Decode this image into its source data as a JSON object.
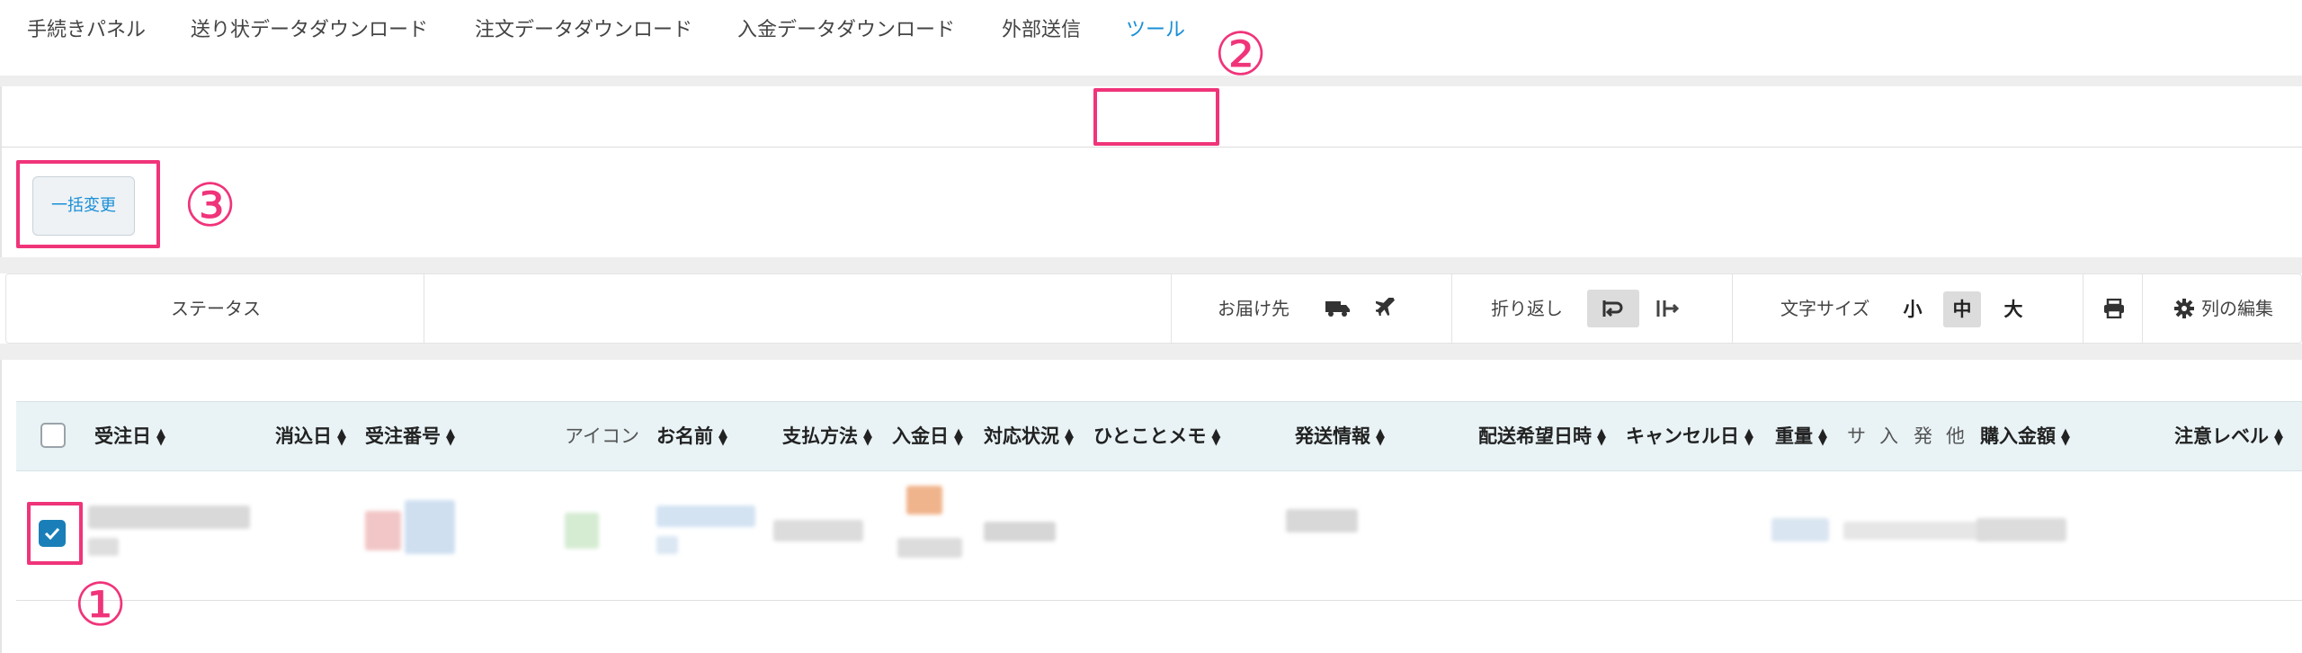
{
  "tabs": [
    {
      "label": "手続きパネル",
      "active": false
    },
    {
      "label": "送り状データダウンロード",
      "active": false
    },
    {
      "label": "注文データダウンロード",
      "active": false
    },
    {
      "label": "入金データダウンロード",
      "active": false
    },
    {
      "label": "外部送信",
      "active": false
    },
    {
      "label": "ツール",
      "active": true
    }
  ],
  "toolbar": {
    "bulk_change_label": "一括変更"
  },
  "filter_bar": {
    "status_label": "ステータス",
    "delivery_label": "お届け先",
    "wrap_label": "折り返し",
    "font_size_label": "文字サイズ",
    "size_small": "小",
    "size_medium": "中",
    "size_large": "大",
    "selected_size": "中",
    "edit_columns_label": "列の編集",
    "icons": [
      "truck-icon",
      "airplane-icon",
      "wrap-on-icon",
      "wrap-off-icon",
      "print-icon",
      "gear-icon"
    ]
  },
  "table": {
    "columns": [
      "受注日",
      "消込日",
      "受注番号",
      "アイコン",
      "お名前",
      "支払方法",
      "入金日",
      "対応状況",
      "ひとことメモ",
      "発送情報",
      "配送希望日時",
      "キャンセル日",
      "重量",
      "サ",
      "入",
      "発",
      "他",
      "購入金額",
      "注意レベル"
    ],
    "row_checked": true
  },
  "annotations": {
    "marker_1": "①",
    "marker_2": "②",
    "marker_3": "③",
    "highlight_color": "#f0347a"
  },
  "colors": {
    "accent": "#1a8fd6",
    "header_bg": "#e9f3f6",
    "checkbox": "#1a7fb8"
  }
}
